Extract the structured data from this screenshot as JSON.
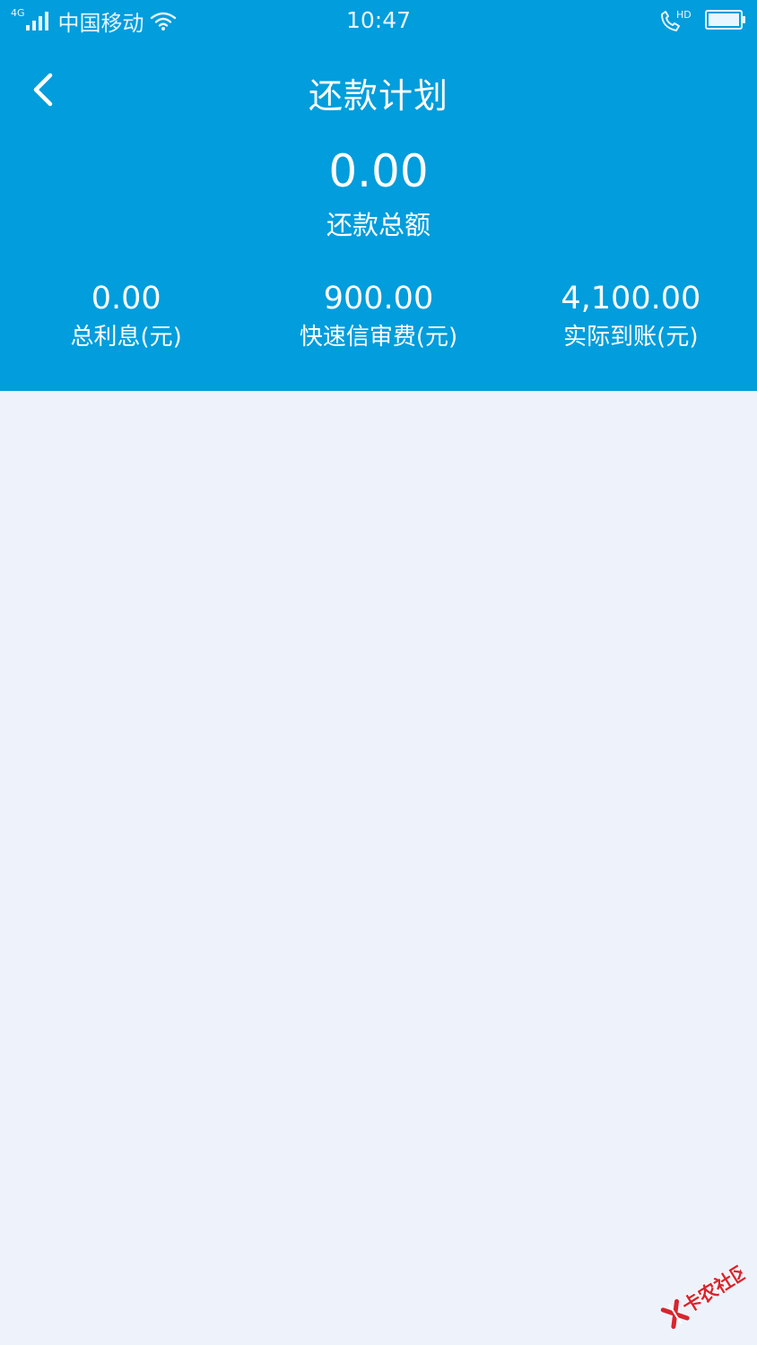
{
  "status_bar": {
    "network": "4G",
    "carrier": "中国移动",
    "time": "10:47",
    "call_label": "HD"
  },
  "nav": {
    "title": "还款计划"
  },
  "summary": {
    "total_amount": "0.00",
    "total_label": "还款总额"
  },
  "stats": [
    {
      "value": "0.00",
      "label": "总利息(元)"
    },
    {
      "value": "900.00",
      "label": "快速信审费(元)"
    },
    {
      "value": "4,100.00",
      "label": "实际到账(元)"
    }
  ],
  "watermark": {
    "text": "卡农社区"
  },
  "colors": {
    "header_bg": "#019ddc",
    "page_bg": "#eef3fb",
    "watermark": "#d8252e"
  }
}
